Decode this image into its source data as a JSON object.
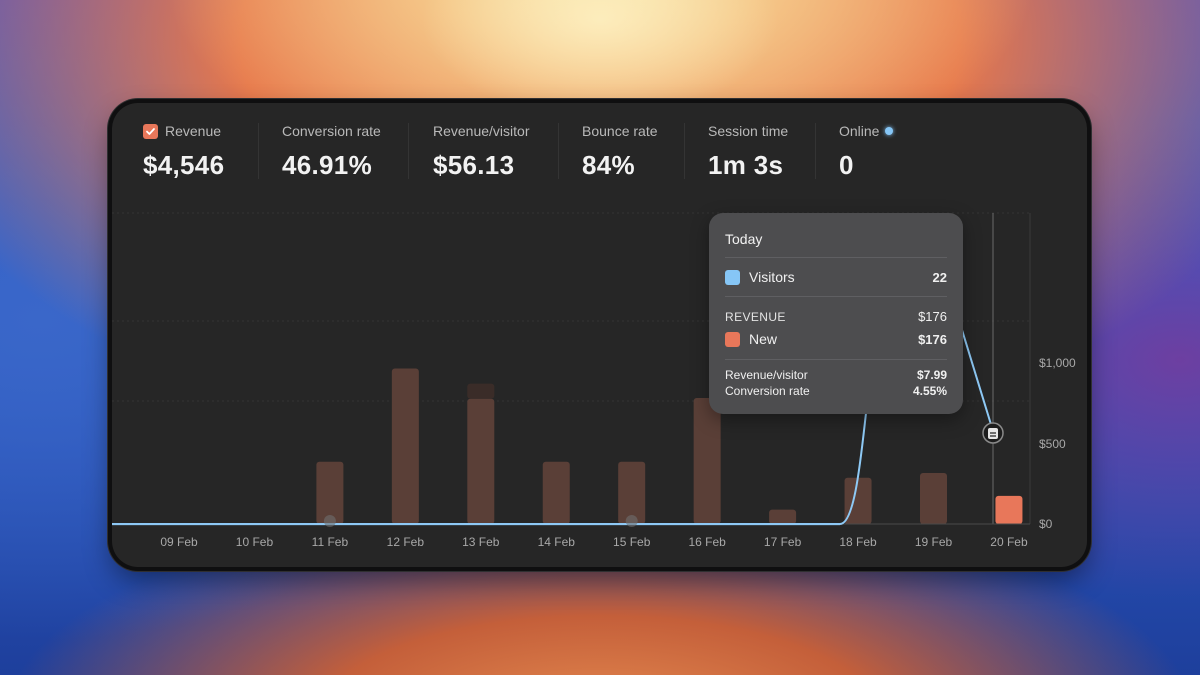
{
  "metrics": [
    {
      "label": "Revenue",
      "value": "$4,546",
      "checked": true
    },
    {
      "label": "Conversion rate",
      "value": "46.91%"
    },
    {
      "label": "Revenue/visitor",
      "value": "$56.13"
    },
    {
      "label": "Bounce rate",
      "value": "84%"
    },
    {
      "label": "Session time",
      "value": "1m 3s"
    },
    {
      "label": "Online",
      "value": "0"
    }
  ],
  "tooltip": {
    "title": "Today",
    "visitors_label": "Visitors",
    "visitors_value": "22",
    "revenue_heading": "REVENUE",
    "revenue_total": "$176",
    "new_label": "New",
    "new_value": "$176",
    "rpv_label": "Revenue/visitor",
    "rpv_value": "$7.99",
    "conv_label": "Conversion rate",
    "conv_value": "4.55%"
  },
  "colors": {
    "revenue": "#e8775a",
    "revenue_bar": "#5a3f37",
    "visitors": "#86c6f6",
    "panel": "#262626"
  },
  "chart_data": {
    "type": "bar",
    "categories": [
      "09 Feb",
      "10 Feb",
      "11 Feb",
      "12 Feb",
      "13 Feb",
      "14 Feb",
      "15 Feb",
      "16 Feb",
      "17 Feb",
      "18 Feb",
      "19 Feb",
      "20 Feb"
    ],
    "series": [
      {
        "name": "Revenue",
        "type": "bar",
        "values": [
          0,
          0,
          390,
          975,
          785,
          390,
          390,
          790,
          90,
          290,
          320,
          176
        ],
        "highlight_index": 11,
        "stacked_top_13Feb": 95
      },
      {
        "name": "Visitors",
        "type": "line",
        "values": [
          0,
          0,
          0,
          0,
          0,
          0,
          0,
          0,
          0,
          0,
          30,
          22
        ]
      }
    ],
    "y_right_ticks": [
      "$0",
      "$500",
      "$1,000"
    ],
    "ylim": [
      0,
      1950
    ],
    "grid": true,
    "event_markers": [
      {
        "category": "11 Feb"
      },
      {
        "category": "15 Feb"
      },
      {
        "category": "20 Feb",
        "icon": "note-icon"
      }
    ]
  }
}
